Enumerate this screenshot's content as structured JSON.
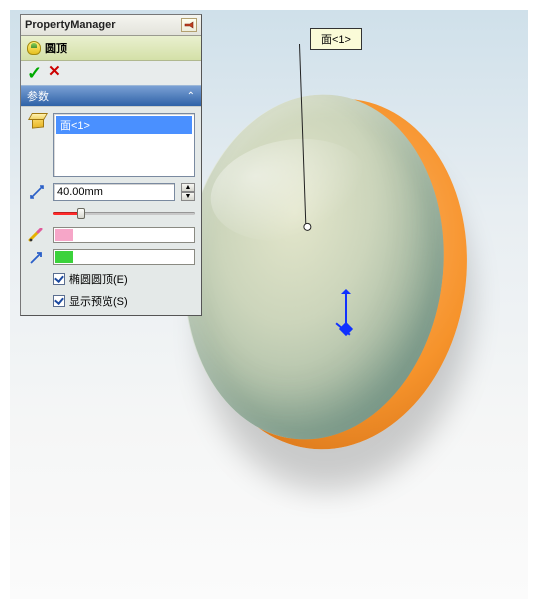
{
  "panel": {
    "title": "PropertyManager",
    "feature": {
      "label": "圆顶"
    },
    "controls": {
      "ok": "✓",
      "cancel": "✕"
    }
  },
  "section": {
    "title": "参数"
  },
  "selection": {
    "items": [
      "面<1>"
    ]
  },
  "distance": {
    "value": "40.00mm"
  },
  "checks": {
    "elliptical": {
      "label": "椭圆圆顶(E)",
      "checked": true
    },
    "preview": {
      "label": "显示预览(S)",
      "checked": true
    }
  },
  "callout": {
    "label": "面<1>"
  }
}
